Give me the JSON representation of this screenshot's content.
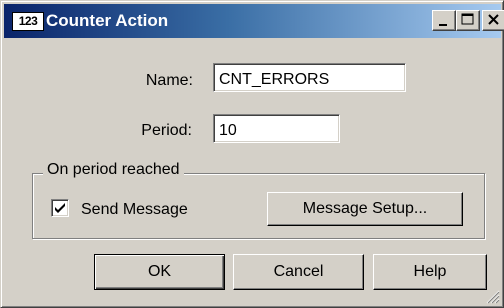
{
  "window": {
    "title": "Counter Action",
    "icon_text": "123",
    "controls": [
      "minimize-icon",
      "maximize-icon",
      "close-icon"
    ]
  },
  "form": {
    "name_label": "Name:",
    "name_value": "CNT_ERRORS",
    "period_label": "Period:",
    "period_value": "10"
  },
  "group": {
    "legend": "On period reached",
    "send_message_label": "Send Message",
    "send_message_checked": true,
    "message_setup_label": "Message Setup..."
  },
  "buttons": {
    "ok": "OK",
    "cancel": "Cancel",
    "help": "Help"
  }
}
